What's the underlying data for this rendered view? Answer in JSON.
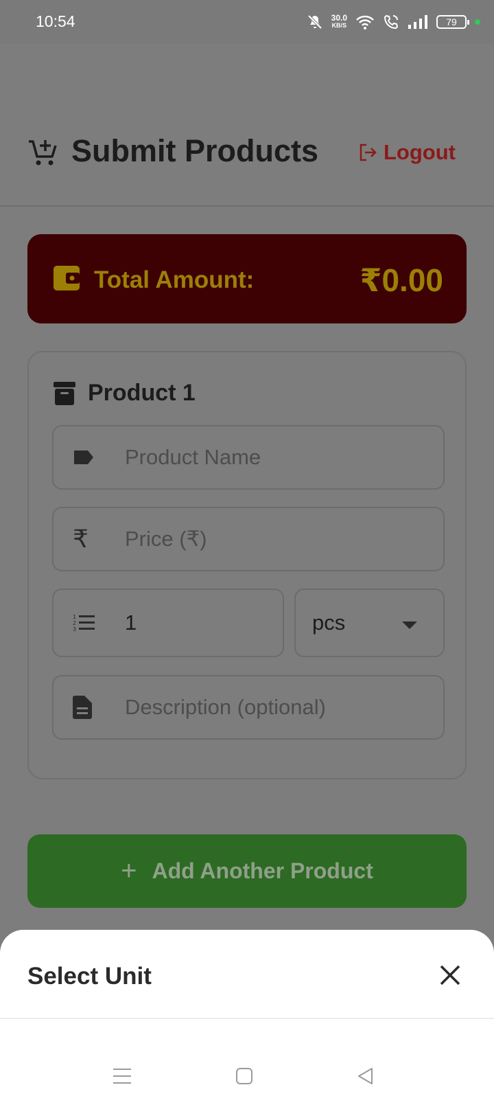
{
  "status_bar": {
    "time": "10:54",
    "net_speed_value": "30.0",
    "net_speed_unit": "KB/S",
    "battery": "79",
    "icons": [
      "mute-icon",
      "wifi-icon",
      "wifi-call-icon",
      "signal-icon",
      "battery-icon"
    ]
  },
  "header": {
    "title": "Submit Products",
    "logout_label": "Logout",
    "icons": [
      "add-cart-icon",
      "logout-icon"
    ]
  },
  "total": {
    "label": "Total Amount:",
    "value": "₹0.00",
    "icon": "wallet-icon"
  },
  "product": {
    "title": "Product 1",
    "icon": "archive-icon",
    "name_placeholder": "Product Name",
    "price_icon": "₹",
    "price_placeholder": "Price (₹)",
    "quantity_value": "1",
    "unit_value": "pcs",
    "description_placeholder": "Description (optional)"
  },
  "add_button": {
    "label": "Add Another Product",
    "icon": "+"
  },
  "sheet": {
    "title": "Select Unit",
    "close_icon": "close-icon"
  },
  "navbar": {
    "icons": [
      "menu-icon",
      "home-icon",
      "back-icon"
    ]
  },
  "colors": {
    "total_card_bg": "#3d0003",
    "gold_text": "#9c8006",
    "add_button_bg": "#2d6a23",
    "logout_text": "#8a1a1a",
    "overlay_bg": "#7d7d7d"
  }
}
